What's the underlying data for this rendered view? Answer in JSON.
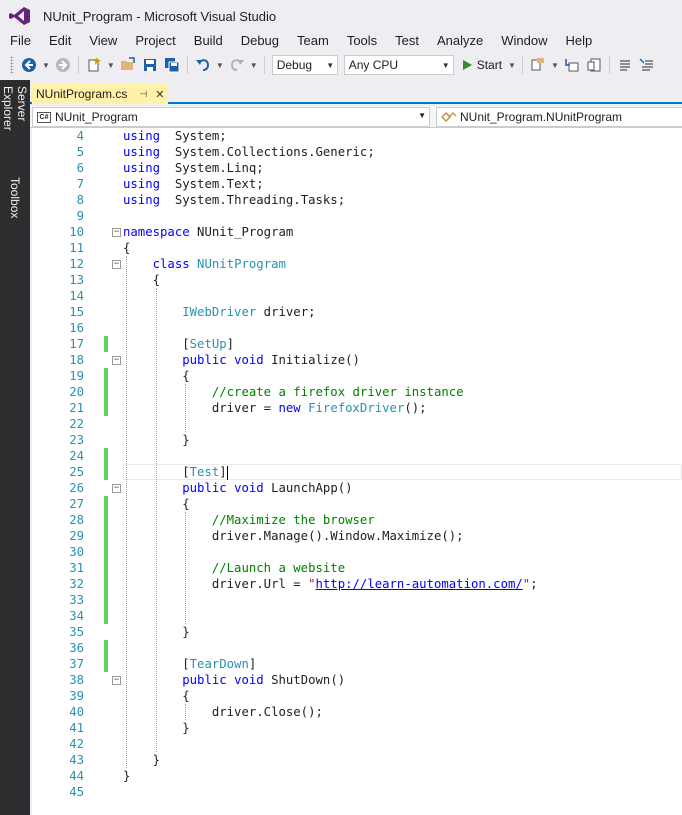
{
  "window": {
    "title": "NUnit_Program - Microsoft Visual Studio"
  },
  "menu": [
    "File",
    "Edit",
    "View",
    "Project",
    "Build",
    "Debug",
    "Team",
    "Tools",
    "Test",
    "Analyze",
    "Window",
    "Help"
  ],
  "toolbar": {
    "config": "Debug",
    "platform": "Any CPU",
    "start_label": "Start"
  },
  "side_tabs": [
    "Server Explorer",
    "Toolbox"
  ],
  "document_tab": {
    "filename": "NUnitProgram.cs"
  },
  "navbar": {
    "project": "NUnit_Program",
    "type": "NUnit_Program.NUnitProgram",
    "project_icon": "C#"
  },
  "colors": {
    "accent": "#007acc",
    "tab_active": "#fff1a8",
    "keyword": "#0000ff",
    "type": "#2b91af",
    "comment": "#008000",
    "string": "#a31515",
    "changed": "#5fd35f"
  },
  "code": [
    {
      "n": 4,
      "chg": false,
      "fold": "",
      "tokens": [
        [
          "kw",
          "using"
        ],
        [
          "",
          "  System;"
        ]
      ]
    },
    {
      "n": 5,
      "chg": false,
      "fold": "",
      "tokens": [
        [
          "kw",
          "using"
        ],
        [
          "",
          "  System.Collections.Generic;"
        ]
      ]
    },
    {
      "n": 6,
      "chg": false,
      "fold": "",
      "tokens": [
        [
          "kw",
          "using"
        ],
        [
          "",
          "  System.Linq;"
        ]
      ]
    },
    {
      "n": 7,
      "chg": false,
      "fold": "",
      "tokens": [
        [
          "kw",
          "using"
        ],
        [
          "",
          "  System.Text;"
        ]
      ]
    },
    {
      "n": 8,
      "chg": false,
      "fold": "",
      "tokens": [
        [
          "kw",
          "using"
        ],
        [
          "",
          "  System.Threading.Tasks;"
        ]
      ]
    },
    {
      "n": 9,
      "chg": false,
      "fold": "",
      "tokens": []
    },
    {
      "n": 10,
      "chg": false,
      "fold": "-",
      "tokens": [
        [
          "kw",
          "namespace"
        ],
        [
          "",
          " NUnit_Program"
        ]
      ]
    },
    {
      "n": 11,
      "chg": false,
      "fold": "",
      "tokens": [
        [
          "",
          "{"
        ]
      ]
    },
    {
      "n": 12,
      "chg": false,
      "fold": "-",
      "tokens": [
        [
          "",
          "    "
        ],
        [
          "kw",
          "class"
        ],
        [
          "",
          ""
        ],
        [
          "ty",
          " NUnitProgram"
        ]
      ]
    },
    {
      "n": 13,
      "chg": false,
      "fold": "",
      "tokens": [
        [
          "",
          "    {"
        ]
      ]
    },
    {
      "n": 14,
      "chg": false,
      "fold": "",
      "tokens": []
    },
    {
      "n": 15,
      "chg": false,
      "fold": "",
      "tokens": [
        [
          "",
          "        "
        ],
        [
          "ty",
          "IWebDriver"
        ],
        [
          "",
          " driver;"
        ]
      ]
    },
    {
      "n": 16,
      "chg": false,
      "fold": "",
      "tokens": []
    },
    {
      "n": 17,
      "chg": true,
      "fold": "",
      "tokens": [
        [
          "",
          "        ["
        ],
        [
          "ty",
          "SetUp"
        ],
        [
          "",
          "]"
        ]
      ]
    },
    {
      "n": 18,
      "chg": false,
      "fold": "-",
      "tokens": [
        [
          "",
          "        "
        ],
        [
          "kw",
          "public"
        ],
        [
          "",
          " "
        ],
        [
          "kw",
          "void"
        ],
        [
          "",
          " Initialize()"
        ]
      ]
    },
    {
      "n": 19,
      "chg": true,
      "fold": "",
      "tokens": [
        [
          "",
          "        {"
        ]
      ]
    },
    {
      "n": 20,
      "chg": true,
      "fold": "",
      "tokens": [
        [
          "",
          "            "
        ],
        [
          "cm",
          "//create a firefox driver instance"
        ]
      ]
    },
    {
      "n": 21,
      "chg": true,
      "fold": "",
      "tokens": [
        [
          "",
          "            driver = "
        ],
        [
          "kw",
          "new"
        ],
        [
          "",
          " "
        ],
        [
          "ty",
          "FirefoxDriver"
        ],
        [
          "",
          "();"
        ]
      ]
    },
    {
      "n": 22,
      "chg": false,
      "fold": "",
      "tokens": []
    },
    {
      "n": 23,
      "chg": false,
      "fold": "",
      "tokens": [
        [
          "",
          "        }"
        ]
      ]
    },
    {
      "n": 24,
      "chg": true,
      "fold": "",
      "tokens": []
    },
    {
      "n": 25,
      "chg": true,
      "fold": "",
      "cursor": true,
      "tokens": [
        [
          "",
          "        ["
        ],
        [
          "ty",
          "Test"
        ],
        [
          "",
          "]"
        ]
      ]
    },
    {
      "n": 26,
      "chg": false,
      "fold": "-",
      "tokens": [
        [
          "",
          "        "
        ],
        [
          "kw",
          "public"
        ],
        [
          "",
          " "
        ],
        [
          "kw",
          "void"
        ],
        [
          "",
          " LaunchApp()"
        ]
      ]
    },
    {
      "n": 27,
      "chg": true,
      "fold": "",
      "tokens": [
        [
          "",
          "        {"
        ]
      ]
    },
    {
      "n": 28,
      "chg": true,
      "fold": "",
      "tokens": [
        [
          "",
          "            "
        ],
        [
          "cm",
          "//Maximize the browser"
        ]
      ]
    },
    {
      "n": 29,
      "chg": true,
      "fold": "",
      "tokens": [
        [
          "",
          "            driver.Manage().Window.Maximize();"
        ]
      ]
    },
    {
      "n": 30,
      "chg": true,
      "fold": "",
      "tokens": []
    },
    {
      "n": 31,
      "chg": true,
      "fold": "",
      "tokens": [
        [
          "",
          "            "
        ],
        [
          "cm",
          "//Launch a website"
        ]
      ]
    },
    {
      "n": 32,
      "chg": true,
      "fold": "",
      "tokens": [
        [
          "",
          "            driver.Url = "
        ],
        [
          "st",
          "\""
        ],
        [
          "url",
          "http://learn-automation.com/"
        ],
        [
          "st",
          "\""
        ],
        [
          "",
          ";"
        ]
      ]
    },
    {
      "n": 33,
      "chg": true,
      "fold": "",
      "tokens": []
    },
    {
      "n": 34,
      "chg": true,
      "fold": "",
      "tokens": []
    },
    {
      "n": 35,
      "chg": false,
      "fold": "",
      "tokens": [
        [
          "",
          "        }"
        ]
      ]
    },
    {
      "n": 36,
      "chg": true,
      "fold": "",
      "tokens": []
    },
    {
      "n": 37,
      "chg": true,
      "fold": "",
      "tokens": [
        [
          "",
          "        ["
        ],
        [
          "ty",
          "TearDown"
        ],
        [
          "",
          "]"
        ]
      ]
    },
    {
      "n": 38,
      "chg": false,
      "fold": "-",
      "tokens": [
        [
          "",
          "        "
        ],
        [
          "kw",
          "public"
        ],
        [
          "",
          " "
        ],
        [
          "kw",
          "void"
        ],
        [
          "",
          " ShutDown()"
        ]
      ]
    },
    {
      "n": 39,
      "chg": false,
      "fold": "",
      "tokens": [
        [
          "",
          "        {"
        ]
      ]
    },
    {
      "n": 40,
      "chg": false,
      "fold": "",
      "tokens": [
        [
          "",
          "            driver.Close();"
        ]
      ]
    },
    {
      "n": 41,
      "chg": false,
      "fold": "",
      "tokens": [
        [
          "",
          "        }"
        ]
      ]
    },
    {
      "n": 42,
      "chg": false,
      "fold": "",
      "tokens": []
    },
    {
      "n": 43,
      "chg": false,
      "fold": "",
      "tokens": [
        [
          "",
          "    }"
        ]
      ]
    },
    {
      "n": 44,
      "chg": false,
      "fold": "",
      "tokens": [
        [
          "",
          "}"
        ]
      ]
    },
    {
      "n": 45,
      "chg": false,
      "fold": "",
      "tokens": []
    }
  ]
}
